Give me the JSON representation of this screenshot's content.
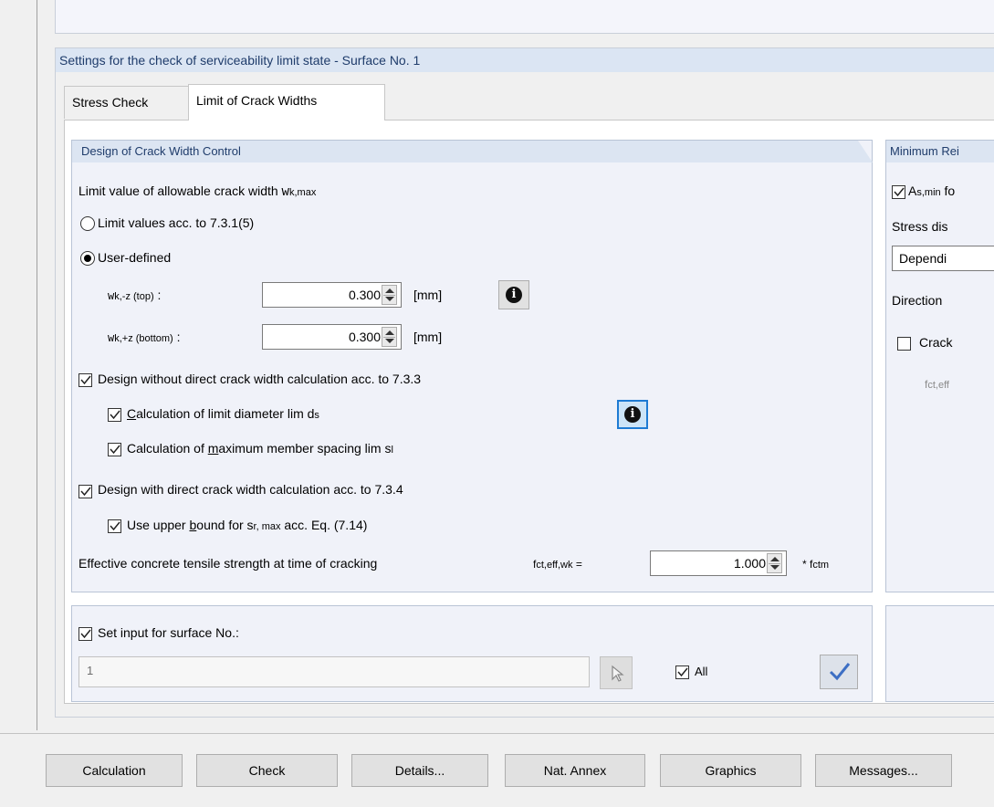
{
  "settings_header": "Settings for the check of serviceability limit state - Surface No. 1",
  "tabs": [
    {
      "label": "Stress Check"
    },
    {
      "label": "Limit of Crack Widths"
    }
  ],
  "crack_width_group": {
    "title": "Design of Crack Width Control",
    "limit_label": "Limit value of allowable crack width",
    "limit_symbol": "w",
    "limit_subscript": "k,max",
    "option_limit_values": "Limit values acc. to 7.3.1(5)",
    "option_user_defined": "User-defined",
    "selected_option": "User-defined",
    "wk_top": {
      "symbol": "w",
      "sub": "k,-z (top)",
      "colon": ":",
      "value": "0.300",
      "unit": "[mm]"
    },
    "wk_bottom": {
      "symbol": "w",
      "sub": "k,+z (bottom)",
      "colon": ":",
      "value": "0.300",
      "unit": "[mm]"
    },
    "design_without_direct": "Design without direct crack width calculation acc. to 7.3.3",
    "calc_limit_diameter_prefix": "C",
    "calc_limit_diameter_rest": "alculation of limit diameter lim d",
    "calc_limit_diameter_sub": "s",
    "calc_max_spacing_prefix": "Calculation of ",
    "calc_max_spacing_mnemonic": "m",
    "calc_max_spacing_rest": "aximum member spacing lim s",
    "calc_max_spacing_sub": "l",
    "design_with_direct": "Design with direct crack width calculation acc. to 7.3.4",
    "upper_bound_prefix": "Use upper ",
    "upper_bound_mnemonic": "b",
    "upper_bound_rest": "ound for s",
    "upper_bound_sub": "r, max",
    "upper_bound_suffix": " acc. Eq. (7.14)",
    "effective_strength_label": "Effective concrete tensile strength at time of cracking",
    "fct_symbol": "f",
    "fct_sub": "ct,eff,wk",
    "fct_eq": "=",
    "fct_value": "1.000",
    "fct_multiplier": "* f",
    "fct_multiplier_sub": "ctm"
  },
  "surface_group": {
    "set_input_label": "Set input for surface No.:",
    "surface_value": "1",
    "all_label": "All"
  },
  "min_reinf_group": {
    "title": "Minimum Rei",
    "as_min_symbol": "A",
    "as_min_sub": "s,min",
    "as_min_rest": " fo",
    "stress_dist_label": "Stress dis",
    "dropdown_value": "Dependi",
    "direction_label": "Direction",
    "crack_label": "Crack",
    "fct_eff_symbol": "f",
    "fct_eff_sub": "ct,eff"
  },
  "buttons": {
    "calculation": "Calculation",
    "check": "Check",
    "details": "Details...",
    "nat_annex": "Nat. Annex",
    "graphics": "Graphics",
    "messages": "Messages..."
  },
  "icons": {
    "info": "info-icon",
    "pick": "pick-surface-icon",
    "apply": "checkmark-icon"
  },
  "colors": {
    "header_bg": "#dbe5f3",
    "group_bg": "#f0f2f9",
    "focus_blue": "#1e7bd3"
  }
}
